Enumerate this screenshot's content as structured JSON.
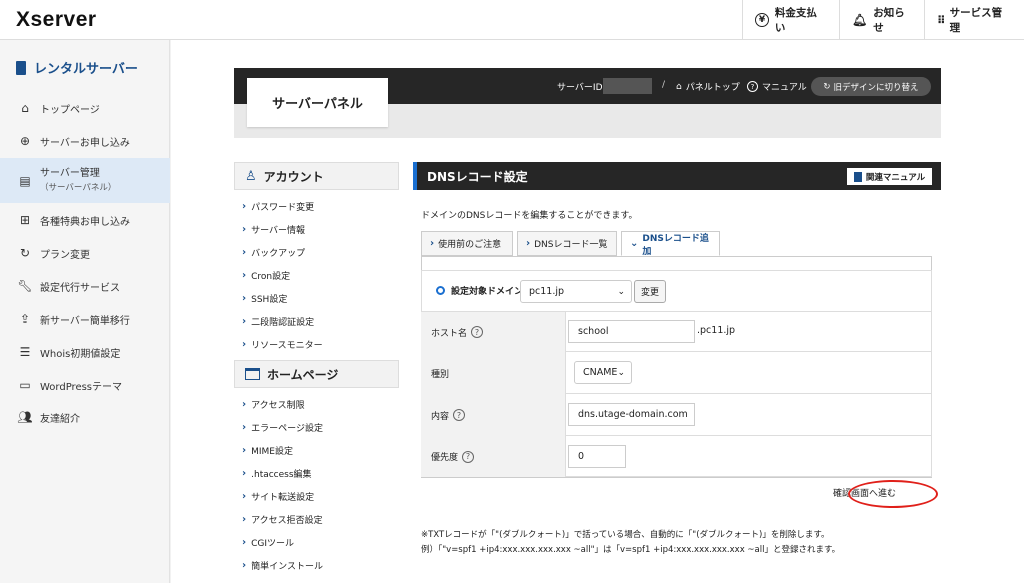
{
  "header": {
    "logo": "Xserver",
    "payment_label": "料金支払い",
    "notice_label": "お知らせ",
    "service_label": "サービス管理"
  },
  "sidebar": {
    "title": "レンタルサーバー",
    "items": [
      {
        "label": "トップページ",
        "icon": "home-icon"
      },
      {
        "label": "サーバーお申し込み",
        "icon": "plus-circle-icon"
      },
      {
        "label": "サーバー管理",
        "sub": "（サーバーパネル）",
        "icon": "server-icon"
      },
      {
        "label": "各種特典お申し込み",
        "icon": "gift-icon"
      },
      {
        "label": "プラン変更",
        "icon": "refresh-icon"
      },
      {
        "label": "設定代行サービス",
        "icon": "wrench-icon"
      },
      {
        "label": "新サーバー簡単移行",
        "icon": "upload-icon"
      },
      {
        "label": "Whois初期値設定",
        "icon": "document-icon"
      },
      {
        "label": "WordPressテーマ",
        "icon": "window-icon"
      },
      {
        "label": "友達紹介",
        "icon": "people-icon"
      }
    ]
  },
  "banner": {
    "panel_title": "サーバーパネル",
    "server_id_label": "サーバーID",
    "separator": "/",
    "panel_top": "パネルトップ",
    "manual": "マニュアル",
    "old_design": "旧デザインに切り替え"
  },
  "menu": {
    "account_head": "アカウント",
    "account_links": [
      "パスワード変更",
      "サーバー情報",
      "バックアップ",
      "Cron設定",
      "SSH設定",
      "二段階認証設定",
      "リソースモニター"
    ],
    "homepage_head": "ホームページ",
    "homepage_links": [
      "アクセス制限",
      "エラーページ設定",
      "MIME設定",
      ".htaccess編集",
      "サイト転送設定",
      "アクセス拒否設定",
      "CGIツール",
      "簡単インストール"
    ]
  },
  "content": {
    "section_title": "DNSレコード設定",
    "manual_button": "関連マニュアル",
    "description": "ドメインのDNSレコードを編集することができます。",
    "tabs": [
      "使用前のご注意",
      "DNSレコード一覧",
      "DNSレコード追加"
    ],
    "domain_label": "設定対象ドメイン",
    "domain_value": "pc11.jp",
    "change_button": "変更",
    "host_label": "ホスト名",
    "host_value": "school",
    "host_suffix": ".pc11.jp",
    "type_label": "種別",
    "type_value": "CNAME",
    "content_label": "内容",
    "content_value": "dns.utage-domain.com",
    "priority_label": "優先度",
    "priority_value": "0",
    "confirm_link": "確認画面へ進む",
    "note1": "※TXTレコードが「\"(ダブルクォート)」で括っている場合、自動的に「\"(ダブルクォート)」を削除します。",
    "note2": "例）「\"v=spf1 +ip4:xxx.xxx.xxx.xxx ~all\"」は「v=spf1 +ip4:xxx.xxx.xxx.xxx ~all」と登録されます。"
  },
  "colors": {
    "accent": "#1a4f8b",
    "highlight_circle": "#e0201a",
    "dark_bar": "#262626"
  }
}
